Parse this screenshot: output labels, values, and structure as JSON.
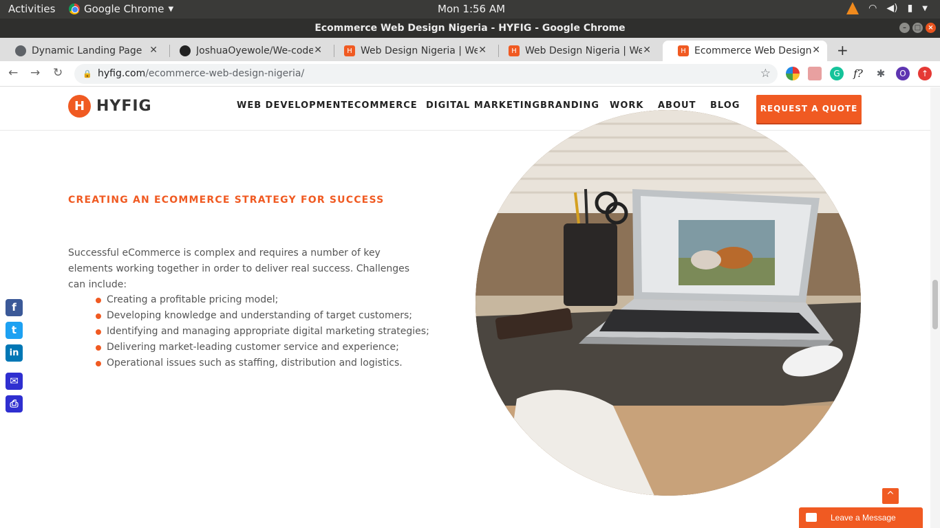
{
  "topbar": {
    "activities": "Activities",
    "app": "Google Chrome",
    "clock": "Mon  1:56 AM"
  },
  "window": {
    "title": "Ecommerce Web Design Nigeria - HYFIG - Google Chrome"
  },
  "tabs": [
    {
      "title": "Dynamic Landing Page",
      "icon": "globe-icon"
    },
    {
      "title": "JoshuaOyewole/We-code",
      "icon": "github-icon"
    },
    {
      "title": "Web Design Nigeria | Web",
      "icon": "hyfig-icon"
    },
    {
      "title": "Web Design Nigeria | Web",
      "icon": "hyfig-icon"
    },
    {
      "title": "Ecommerce Web Design N",
      "icon": "hyfig-icon"
    }
  ],
  "address": {
    "domain": "hyfig.com",
    "path": "/ecommerce-web-design-nigeria/"
  },
  "extensions": {
    "profile_initial": "O",
    "formula": "f?"
  },
  "site": {
    "logo_mark": "H",
    "logo_text": "HYFIG",
    "nav": [
      "WEB DEVELOPMENT",
      "ECOMMERCE",
      "DIGITAL MARKETING",
      "BRANDING",
      "WORK",
      "ABOUT",
      "BLOG"
    ],
    "cta": "REQUEST A QUOTE"
  },
  "content": {
    "heading": "CREATING AN ECOMMERCE STRATEGY FOR SUCCESS",
    "intro": "Successful eCommerce is complex and requires a number of key elements working together in order to deliver real success. Challenges can include:",
    "bullets": [
      "Creating a profitable pricing model;",
      "Developing knowledge and understanding of target customers;",
      "Identifying and managing appropriate digital marketing strategies;",
      "Delivering market-leading customer service and experience;",
      "Operational issues such as staffing, distribution and logistics."
    ]
  },
  "share": [
    {
      "name": "facebook",
      "glyph": "f",
      "color": "#3b5998"
    },
    {
      "name": "twitter",
      "glyph": "t",
      "color": "#1da1f2"
    },
    {
      "name": "linkedin",
      "glyph": "in",
      "color": "#0077b5"
    },
    {
      "name": "email",
      "glyph": "✉",
      "color": "#2f2fd0"
    },
    {
      "name": "print",
      "glyph": "⎙",
      "color": "#2f2fd0"
    }
  ],
  "widgets": {
    "leave_message": "Leave a Message",
    "to_top": "^"
  },
  "colors": {
    "brand": "#f05a22"
  }
}
